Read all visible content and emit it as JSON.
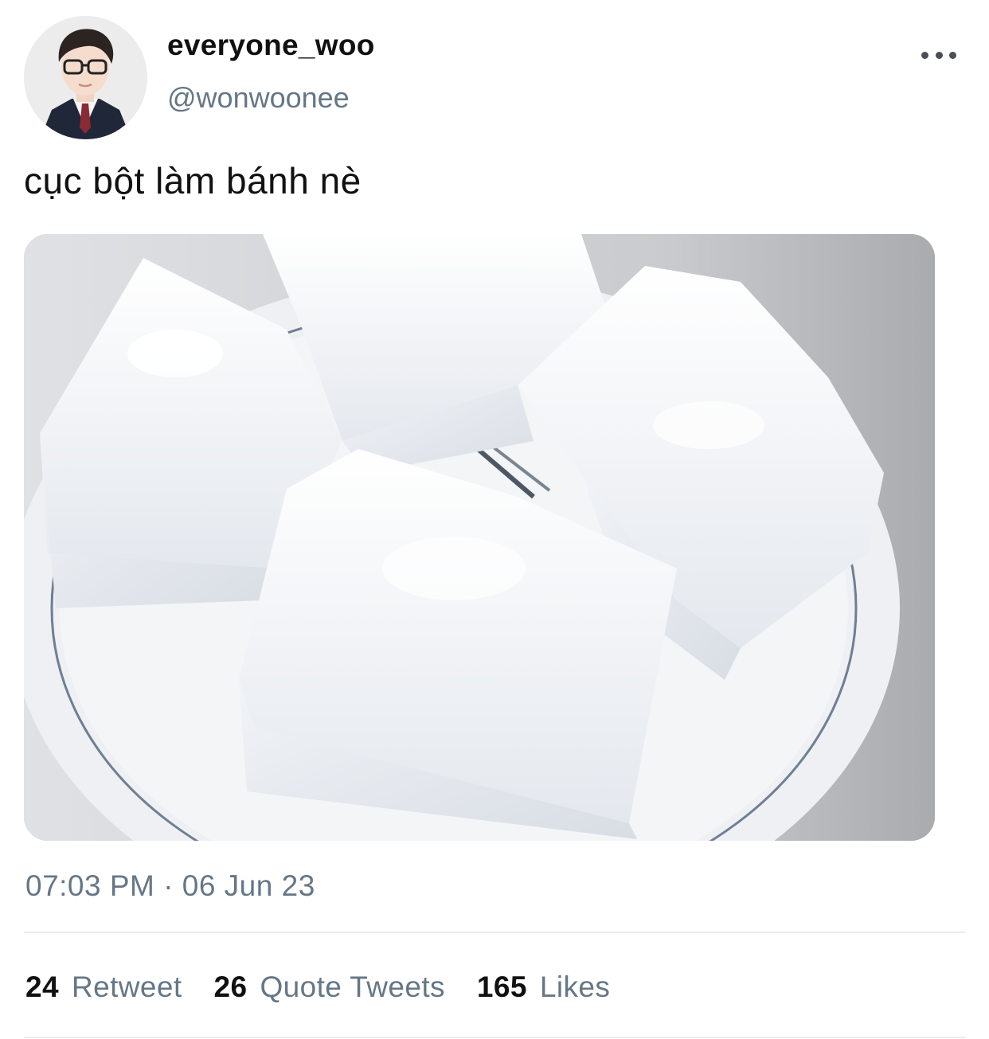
{
  "author": {
    "display_name": "everyone_woo",
    "handle": "@wonwoonee",
    "avatar_icon": "profile-photo"
  },
  "header": {
    "more_icon": "more-horizontal-icon"
  },
  "tweet": {
    "text": "cục bột làm bánh nè",
    "timestamp": "07:03 PM · 06 Jun 23"
  },
  "media": {
    "type": "photo"
  },
  "stats": [
    {
      "count": "24",
      "label": "Retweet"
    },
    {
      "count": "26",
      "label": "Quote Tweets"
    },
    {
      "count": "165",
      "label": "Likes"
    }
  ],
  "colors": {
    "text_primary": "#0f1419",
    "text_secondary": "#657786",
    "divider": "#e6ecf0"
  }
}
